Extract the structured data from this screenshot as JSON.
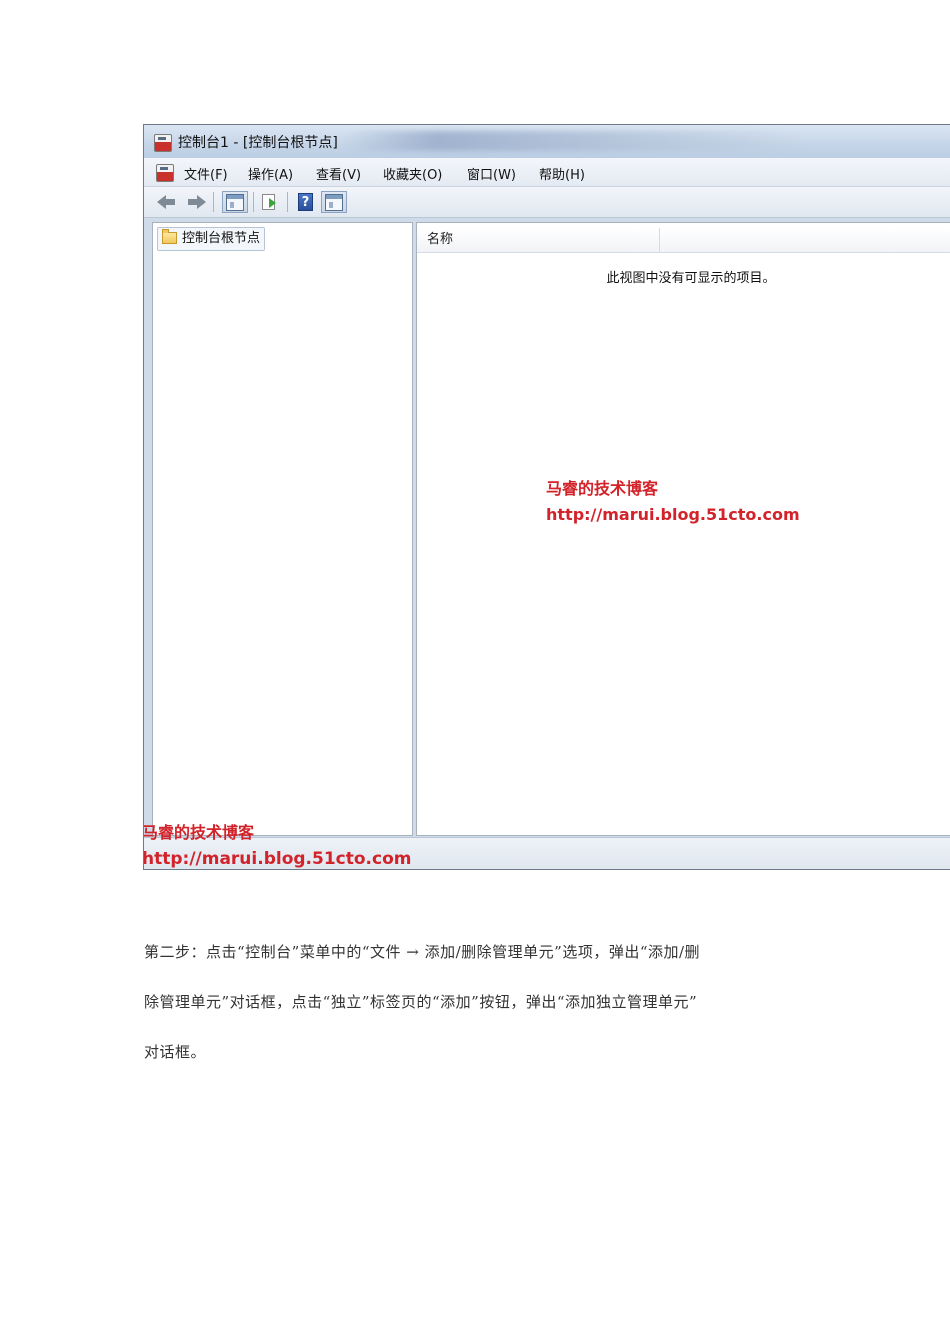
{
  "window": {
    "title": "控制台1 - [控制台根节点]",
    "menu": [
      "文件(F)",
      "操作(A)",
      "查看(V)",
      "收藏夹(O)",
      "窗口(W)",
      "帮助(H)"
    ],
    "toolbar_icons": [
      "back-arrow-icon",
      "forward-arrow-icon",
      "show-hide-console-tree-icon",
      "export-list-icon",
      "help-icon",
      "show-hide-action-pane-icon"
    ],
    "tree_root": "控制台根节点",
    "list_column": "名称",
    "empty_message": "此视图中没有可显示的项目。",
    "watermark": {
      "title": "马睿的技术博客",
      "url": "http://marui.blog.51cto.com"
    },
    "colors": {
      "watermark": "#d2232a",
      "window_frame": "#cfdbe8"
    }
  },
  "document": {
    "paragraph_lines": [
      "第二步：点击“控制台”菜单中的“文件 → 添加/删除管理单元”选项，弹出“添加/删",
      "除管理单元”对话框，点击“独立”标签页的“添加”按钮，弹出“添加独立管理单元”",
      "对话框。"
    ]
  }
}
